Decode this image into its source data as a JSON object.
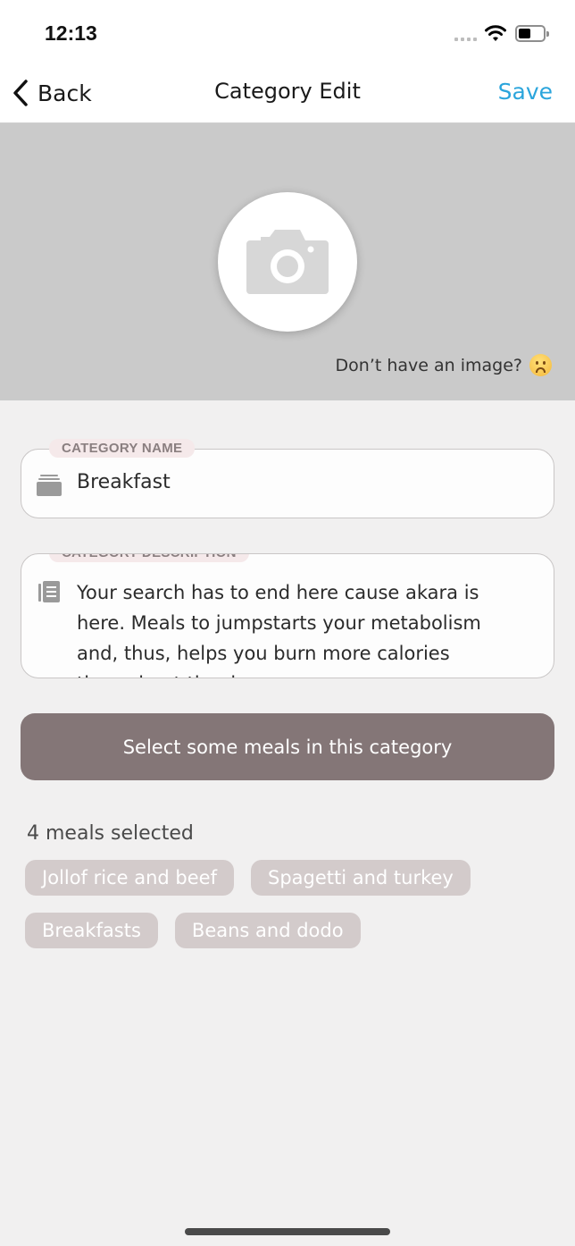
{
  "status_bar": {
    "time": "12:13",
    "icons": [
      "signal-dots-icon",
      "wifi-icon",
      "battery-icon"
    ]
  },
  "nav": {
    "back_label": "Back",
    "title": "Category Edit",
    "save_label": "Save",
    "save_color": "#2ba5dc"
  },
  "image_header": {
    "placeholder_icon": "camera-icon",
    "no_image_text": "Don’t have an image?",
    "no_image_emoji": "frowning-face-icon"
  },
  "form": {
    "name": {
      "label": "CATEGORY NAME",
      "icon": "folder-stack-icon",
      "value": "Breakfast"
    },
    "description": {
      "label": "CATEGORY DESCRIPTION",
      "icon": "document-icon",
      "value": "Your search has to end here cause akara is here.  Meals to jumpstarts your metabolism and, thus, helps you burn more calories throughout the day."
    }
  },
  "select_button": {
    "label": "Select some meals in this category",
    "color": "#847677"
  },
  "meals": {
    "count_text": "4 meals selected",
    "selected": [
      {
        "label": "Jollof rice and beef"
      },
      {
        "label": "Spagetti and turkey"
      },
      {
        "label": "Breakfasts"
      },
      {
        "label": "Beans and dodo"
      }
    ]
  }
}
